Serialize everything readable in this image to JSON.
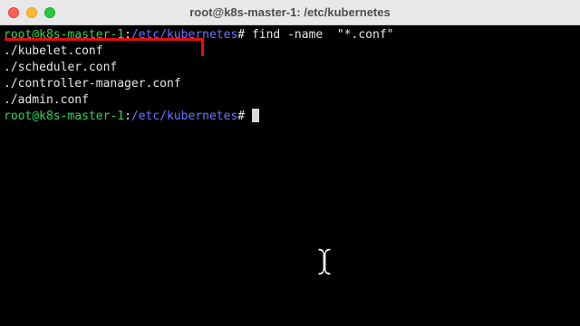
{
  "window": {
    "title": "root@k8s-master-1: /etc/kubernetes"
  },
  "terminal": {
    "prompt": {
      "user_host": "root@k8s-master-1",
      "separator": ":",
      "path": "/etc/kubernetes",
      "symbol": "# "
    },
    "command": "find -name  \"*.conf\"",
    "output": [
      "./kubelet.conf",
      "./scheduler.conf",
      "./controller-manager.conf",
      "./admin.conf"
    ]
  },
  "colors": {
    "prompt_user": "#31d45b",
    "prompt_path": "#6d74ff",
    "annotation": "#e01010"
  },
  "icons": {
    "mouse_cursor": "ibeam-cursor-icon"
  }
}
